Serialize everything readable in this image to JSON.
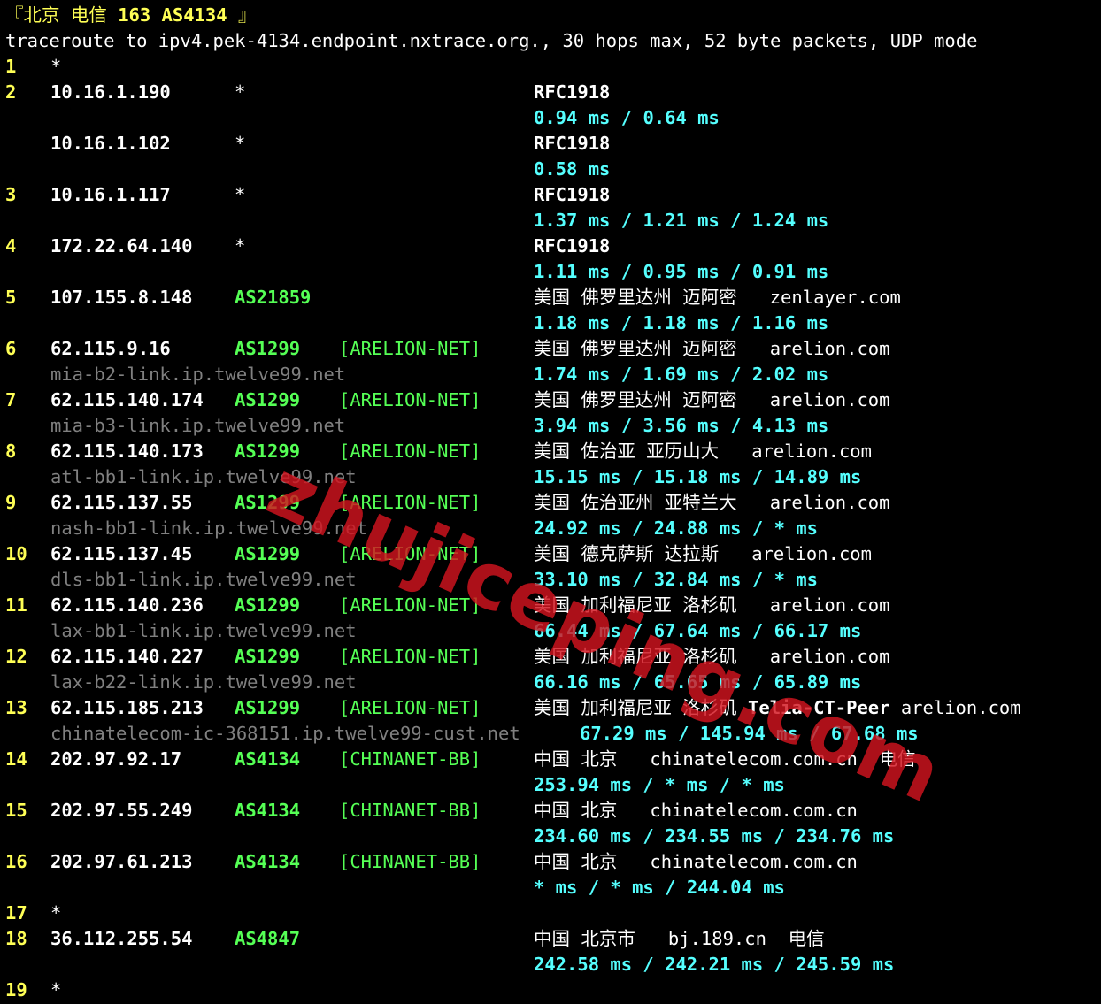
{
  "header": {
    "bracket_open": "『",
    "city": "北京",
    "carrier": "电信",
    "net_label": "163 AS4134",
    "bracket_close": "』"
  },
  "command": "traceroute to ipv4.pek-4134.endpoint.nxtrace.org., 30 hops max, 52 byte packets, UDP mode",
  "hops": [
    {
      "hop": "1",
      "entries": [
        {
          "ip": "*"
        }
      ]
    },
    {
      "hop": "2",
      "entries": [
        {
          "ip": "10.16.1.190",
          "asn": "*",
          "geo": "RFC1918",
          "rtt": [
            "0.94 ms",
            "0.64 ms"
          ]
        },
        {
          "ip": "10.16.1.102",
          "asn": "*",
          "geo": "RFC1918",
          "rtt": [
            "0.58 ms"
          ]
        }
      ]
    },
    {
      "hop": "3",
      "entries": [
        {
          "ip": "10.16.1.117",
          "asn": "*",
          "geo": "RFC1918",
          "rtt": [
            "1.37 ms",
            "1.21 ms",
            "1.24 ms"
          ]
        }
      ]
    },
    {
      "hop": "4",
      "entries": [
        {
          "ip": "172.22.64.140",
          "asn": "*",
          "geo": "RFC1918",
          "rtt": [
            "1.11 ms",
            "0.95 ms",
            "0.91 ms"
          ]
        }
      ]
    },
    {
      "hop": "5",
      "entries": [
        {
          "ip": "107.155.8.148",
          "asn": "AS21859",
          "geo": "美国 佛罗里达州 迈阿密",
          "domain": "zenlayer.com",
          "rtt": [
            "1.18 ms",
            "1.18 ms",
            "1.16 ms"
          ]
        }
      ]
    },
    {
      "hop": "6",
      "entries": [
        {
          "ip": "62.115.9.16",
          "asn": "AS1299",
          "net": "[ARELION-NET]",
          "geo": "美国 佛罗里达州 迈阿密",
          "domain": "arelion.com",
          "rdns": "mia-b2-link.ip.twelve99.net",
          "rtt": [
            "1.74 ms",
            "1.69 ms",
            "2.02 ms"
          ]
        }
      ]
    },
    {
      "hop": "7",
      "entries": [
        {
          "ip": "62.115.140.174",
          "asn": "AS1299",
          "net": "[ARELION-NET]",
          "geo": "美国 佛罗里达州 迈阿密",
          "domain": "arelion.com",
          "rdns": "mia-b3-link.ip.twelve99.net",
          "rtt": [
            "3.94 ms",
            "3.56 ms",
            "4.13 ms"
          ]
        }
      ]
    },
    {
      "hop": "8",
      "entries": [
        {
          "ip": "62.115.140.173",
          "asn": "AS1299",
          "net": "[ARELION-NET]",
          "geo": "美国 佐治亚 亚历山大",
          "domain": "arelion.com",
          "rdns": "atl-bb1-link.ip.twelve99.net",
          "rtt": [
            "15.15 ms",
            "15.18 ms",
            "14.89 ms"
          ]
        }
      ]
    },
    {
      "hop": "9",
      "entries": [
        {
          "ip": "62.115.137.55",
          "asn": "AS1299",
          "net": "[ARELION-NET]",
          "geo": "美国 佐治亚州 亚特兰大",
          "domain": "arelion.com",
          "rdns": "nash-bb1-link.ip.twelve99.net",
          "rtt": [
            "24.92 ms",
            "24.88 ms",
            "* ms"
          ]
        }
      ]
    },
    {
      "hop": "10",
      "entries": [
        {
          "ip": "62.115.137.45",
          "asn": "AS1299",
          "net": "[ARELION-NET]",
          "geo": "美国 德克萨斯 达拉斯",
          "domain": "arelion.com",
          "rdns": "dls-bb1-link.ip.twelve99.net",
          "rtt": [
            "33.10 ms",
            "32.84 ms",
            "* ms"
          ]
        }
      ]
    },
    {
      "hop": "11",
      "entries": [
        {
          "ip": "62.115.140.236",
          "asn": "AS1299",
          "net": "[ARELION-NET]",
          "geo": "美国 加利福尼亚 洛杉矶",
          "domain": "arelion.com",
          "rdns": "lax-bb1-link.ip.twelve99.net",
          "rtt": [
            "66.44 ms",
            "67.64 ms",
            "66.17 ms"
          ]
        }
      ]
    },
    {
      "hop": "12",
      "entries": [
        {
          "ip": "62.115.140.227",
          "asn": "AS1299",
          "net": "[ARELION-NET]",
          "geo": "美国 加利福尼亚 洛杉矶",
          "domain": "arelion.com",
          "rdns": "lax-b22-link.ip.twelve99.net",
          "rtt": [
            "66.16 ms",
            "65.65 ms",
            "65.89 ms"
          ]
        }
      ]
    },
    {
      "hop": "13",
      "entries": [
        {
          "ip": "62.115.185.213",
          "asn": "AS1299",
          "net": "[ARELION-NET]",
          "geo": "美国 加利福尼亚 洛杉矶",
          "peer": "Telia-CT-Peer",
          "domain": "arelion.com",
          "rdns": "chinatelecom-ic-368151.ip.twelve99-cust.net",
          "rtt": [
            "67.29 ms",
            "145.94 ms",
            "67.68 ms"
          ]
        }
      ]
    },
    {
      "hop": "14",
      "entries": [
        {
          "ip": "202.97.92.17",
          "asn": "AS4134",
          "net": "[CHINANET-BB]",
          "geo": "中国 北京",
          "domain": "chinatelecom.com.cn",
          "isp": "电信",
          "rtt": [
            "253.94 ms",
            "* ms",
            "* ms"
          ]
        }
      ]
    },
    {
      "hop": "15",
      "entries": [
        {
          "ip": "202.97.55.249",
          "asn": "AS4134",
          "net": "[CHINANET-BB]",
          "geo": "中国 北京",
          "domain": "chinatelecom.com.cn",
          "rtt": [
            "234.60 ms",
            "234.55 ms",
            "234.76 ms"
          ]
        }
      ]
    },
    {
      "hop": "16",
      "entries": [
        {
          "ip": "202.97.61.213",
          "asn": "AS4134",
          "net": "[CHINANET-BB]",
          "geo": "中国 北京",
          "domain": "chinatelecom.com.cn",
          "rtt": [
            "* ms",
            "* ms",
            "244.04 ms"
          ]
        }
      ]
    },
    {
      "hop": "17",
      "entries": [
        {
          "ip": "*"
        }
      ]
    },
    {
      "hop": "18",
      "entries": [
        {
          "ip": "36.112.255.54",
          "asn": "AS4847",
          "geo": "中国 北京市",
          "domain": "bj.189.cn",
          "isp": "电信",
          "rtt": [
            "242.58 ms",
            "242.21 ms",
            "245.59 ms"
          ]
        }
      ]
    },
    {
      "hop": "19",
      "entries": [
        {
          "ip": "*"
        }
      ]
    }
  ],
  "watermark": "zhujiceping.com",
  "colors": {
    "hop": "#ffff55",
    "asn": "#55ff55",
    "rtt": "#55ffff",
    "rdns": "#808080",
    "watermark": "#d2141e"
  }
}
